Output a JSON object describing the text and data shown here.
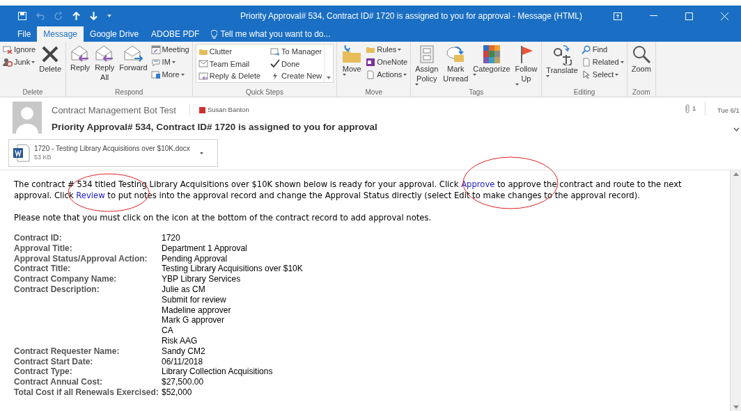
{
  "window": {
    "title": "Priority Approval# 534, Contract ID# 1720 is assigned to you for approval - Message (HTML)"
  },
  "tabs": [
    {
      "label": "File",
      "selected": false
    },
    {
      "label": "Message",
      "selected": true
    },
    {
      "label": "Google Drive",
      "selected": false
    },
    {
      "label": "ADOBE PDF",
      "selected": false
    }
  ],
  "tell_me": {
    "placeholder": "Tell me what you want to do..."
  },
  "ribbon": {
    "groups": [
      {
        "label": "Delete",
        "columns": [
          [
            {
              "label": "Ignore",
              "dropdown": false
            },
            {
              "label": "Junk",
              "dropdown": true
            }
          ],
          [
            {
              "label": "Delete",
              "dropdown": false,
              "kind": "large"
            }
          ]
        ]
      },
      {
        "label": "Respond",
        "columns": [
          [
            {
              "label": "Reply",
              "dropdown": false,
              "kind": "large"
            }
          ],
          [
            {
              "label": "Reply\nAll",
              "dropdown": false,
              "kind": "large"
            }
          ],
          [
            {
              "label": "Forward",
              "dropdown": false,
              "kind": "large"
            }
          ],
          [
            {
              "label": "Meeting",
              "dropdown": false
            },
            {
              "label": "IM",
              "dropdown": true
            },
            {
              "label": "More",
              "dropdown": true
            }
          ]
        ]
      },
      {
        "label": "Quick Steps",
        "kind": "gallery",
        "columns": [
          [
            {
              "label": "Clutter",
              "dropdown": false
            },
            {
              "label": "Team Email",
              "dropdown": false
            },
            {
              "label": "Reply & Delete",
              "dropdown": false
            }
          ],
          [
            {
              "label": "To Manager",
              "dropdown": false
            },
            {
              "label": "Done",
              "dropdown": false
            },
            {
              "label": "Create New",
              "dropdown": false
            }
          ]
        ]
      },
      {
        "label": "Move",
        "columns": [
          [
            {
              "label": "Move",
              "dropdown": true,
              "kind": "large"
            }
          ],
          [
            {
              "label": "Rules",
              "dropdown": true
            },
            {
              "label": "OneNote",
              "dropdown": false
            },
            {
              "label": "Actions",
              "dropdown": true
            }
          ]
        ]
      },
      {
        "label": "Tags",
        "columns": [
          [
            {
              "label": "Assign\nPolicy",
              "dropdown": true,
              "kind": "large"
            }
          ],
          [
            {
              "label": "Mark\nUnread",
              "dropdown": false,
              "kind": "large"
            }
          ],
          [
            {
              "label": "Categorize",
              "dropdown": true,
              "kind": "large"
            }
          ],
          [
            {
              "label": "Follow\nUp",
              "dropdown": true,
              "kind": "large"
            }
          ]
        ]
      },
      {
        "label": "Editing",
        "columns": [
          [
            {
              "label": "Translate",
              "dropdown": true,
              "kind": "large"
            }
          ],
          [
            {
              "label": "Find",
              "dropdown": false
            },
            {
              "label": "Related",
              "dropdown": true
            },
            {
              "label": "Select",
              "dropdown": true
            }
          ]
        ]
      },
      {
        "label": "Zoom",
        "columns": [
          [
            {
              "label": "Zoom",
              "dropdown": false,
              "kind": "large"
            }
          ]
        ]
      }
    ]
  },
  "message": {
    "sender": "Contract Management Bot Test",
    "recipient": "Susan Banton",
    "attachment_count": "1",
    "date": "Tue 6/1",
    "subject": "Priority Approval# 534, Contract ID# 1720 is assigned to you for approval",
    "attachment": {
      "name": "1720 - Testing Library Acquisitions over $10K.docx",
      "size": "53 KB"
    }
  },
  "body": {
    "paragraphs": [
      [
        {
          "kind": "text",
          "text": "The contract # 534 titled Testing Library Acquisitions over $10K shown below is ready for your approval.  Click "
        },
        {
          "kind": "link",
          "text": "Approve",
          "circled": true
        },
        {
          "kind": "text",
          "text": " to approve the contract and route to the next approval.  Click "
        },
        {
          "kind": "link",
          "text": "Review",
          "circled": true
        },
        {
          "kind": "text",
          "text": " to put notes into the approval record and change the Approval Status directly (select Edit to make changes to the approval record)."
        }
      ],
      [
        {
          "kind": "text",
          "text": "Please note that you must click on the icon at the bottom of the contract record to add approval notes."
        }
      ]
    ],
    "fields": [
      {
        "label": "Contract ID:",
        "values": [
          "1720"
        ]
      },
      {
        "label": "Approval Title:",
        "values": [
          "Department 1 Approval"
        ]
      },
      {
        "label": "Approval Status/Approval Action:",
        "values": [
          "Pending Approval"
        ]
      },
      {
        "label": "Contract Title:",
        "values": [
          "Testing Library Acquisitions over $10K"
        ]
      },
      {
        "label": "Contract Company Name:",
        "values": [
          "YBP Library Services"
        ]
      },
      {
        "label": "Contract Description:",
        "values": [
          "Julie as CM",
          "Submit for review",
          "Madeline approver",
          "Mark G approver",
          "CA",
          "Risk AAG"
        ]
      },
      {
        "label": "Contract Requester Name:",
        "values": [
          "Sandy CM2"
        ]
      },
      {
        "label": "Contract Start Date:",
        "values": [
          "06/11/2018"
        ]
      },
      {
        "label": "Contract Type:",
        "values": [
          "Library Collection Acquisitions"
        ]
      },
      {
        "label": "Contract Annual Cost:",
        "values": [
          "$27,500.00"
        ]
      },
      {
        "label": "Total Cost if all Renewals Exercised:",
        "values": [
          "$52,000"
        ]
      }
    ]
  }
}
